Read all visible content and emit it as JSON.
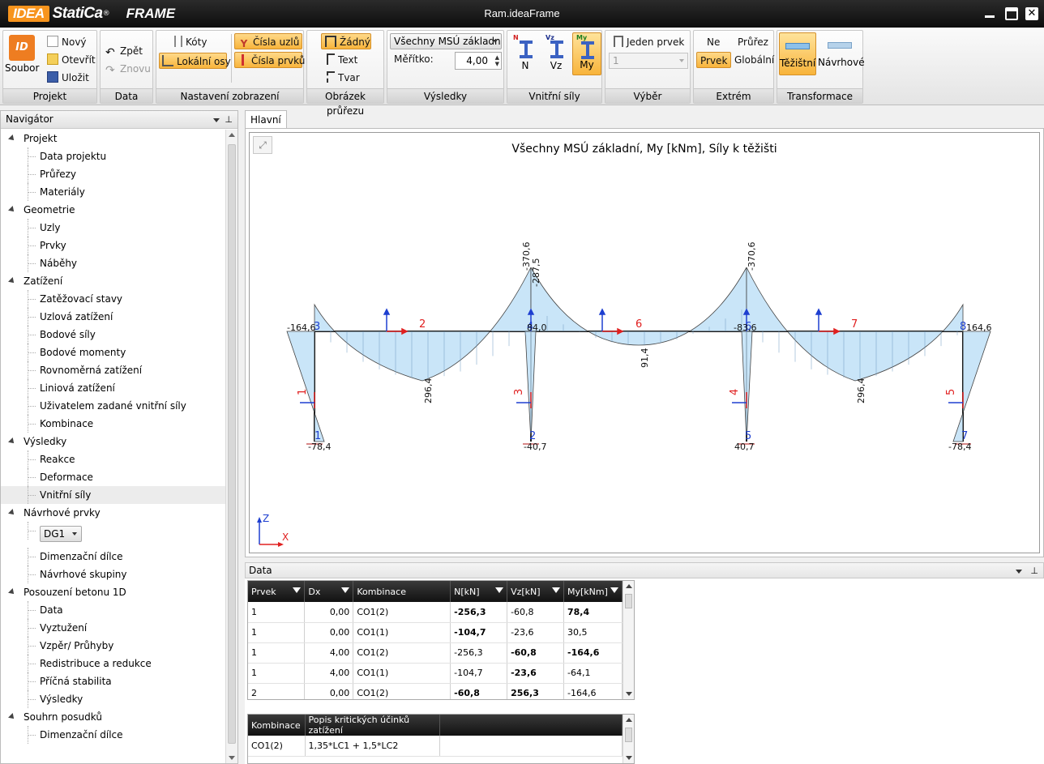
{
  "app": {
    "brand_idea": "IDEA",
    "brand_statica": "StatiCa",
    "brand_reg": "®",
    "product": "FRAME",
    "window_title": "Ram.ideaFrame"
  },
  "ribbon": {
    "projekt": {
      "label": "Projekt",
      "soubor": "Soubor",
      "novy": "Nový",
      "otevrit": "Otevřít",
      "ulozit": "Uložit"
    },
    "data": {
      "label": "Data",
      "zpet": "Zpět",
      "znovu": "Znovu"
    },
    "nastaveni": {
      "label": "Nastavení zobrazení",
      "koty": "Kóty",
      "lokalni_osy": "Lokální osy",
      "cisla_uzlu": "Čísla uzlů",
      "cisla_prvku": "Čísla prvků"
    },
    "obrazek": {
      "label": "Obrázek průřezu",
      "zadny": "Žádný",
      "text": "Text",
      "tvar": "Tvar"
    },
    "vysledky": {
      "label": "Výsledky",
      "combo": "Všechny MSÚ základní",
      "meritko_label": "Měřítko:",
      "meritko_value": "4,00"
    },
    "vnitrni": {
      "label": "Vnitřní síly",
      "n": "N",
      "vz": "Vz",
      "my": "My",
      "n_tag": "N",
      "vz_tag": "Vz",
      "my_tag": "My"
    },
    "vyber": {
      "label": "Výběr",
      "jeden_prvek": "Jeden prvek",
      "value": "1"
    },
    "extrem": {
      "label": "Extrém",
      "ne": "Ne",
      "prvek": "Prvek",
      "prurez": "Průřez",
      "globalni": "Globální"
    },
    "transformace": {
      "label": "Transformace",
      "tezistni": "Těžištní",
      "navrhove": "Návrhové"
    }
  },
  "navigator": {
    "title": "Navigátor",
    "items": [
      {
        "t": "sec",
        "label": "Projekt"
      },
      {
        "t": "sub",
        "label": "Data projektu"
      },
      {
        "t": "sub",
        "label": "Průřezy"
      },
      {
        "t": "sub",
        "label": "Materiály"
      },
      {
        "t": "sec",
        "label": "Geometrie"
      },
      {
        "t": "sub",
        "label": "Uzly"
      },
      {
        "t": "sub",
        "label": "Prvky"
      },
      {
        "t": "sub",
        "label": "Náběhy"
      },
      {
        "t": "sec",
        "label": "Zatížení"
      },
      {
        "t": "sub",
        "label": "Zatěžovací stavy"
      },
      {
        "t": "sub",
        "label": "Uzlová zatížení"
      },
      {
        "t": "sub",
        "label": "Bodové síly"
      },
      {
        "t": "sub",
        "label": "Bodové momenty"
      },
      {
        "t": "sub",
        "label": "Rovnoměrná zatížení"
      },
      {
        "t": "sub",
        "label": "Liniová zatížení"
      },
      {
        "t": "sub",
        "label": "Uživatelem zadané vnitřní síly"
      },
      {
        "t": "sub",
        "label": "Kombinace"
      },
      {
        "t": "sec",
        "label": "Výsledky"
      },
      {
        "t": "sub",
        "label": "Reakce"
      },
      {
        "t": "sub",
        "label": "Deformace"
      },
      {
        "t": "sub",
        "label": "Vnitřní síly",
        "sel": true
      },
      {
        "t": "sec",
        "label": "Návrhové prvky"
      },
      {
        "t": "combo",
        "label": "DG1"
      },
      {
        "t": "sub",
        "label": "Dimenzační dílce"
      },
      {
        "t": "sub",
        "label": "Návrhové skupiny"
      },
      {
        "t": "sec",
        "label": "Posouzení betonu 1D"
      },
      {
        "t": "sub",
        "label": "Data"
      },
      {
        "t": "sub",
        "label": "Vyztužení"
      },
      {
        "t": "sub",
        "label": "Vzpěr/ Průhyby"
      },
      {
        "t": "sub",
        "label": "Redistribuce a redukce"
      },
      {
        "t": "sub",
        "label": "Příčná stabilita"
      },
      {
        "t": "sub",
        "label": "Výsledky"
      },
      {
        "t": "sec",
        "label": "Souhrn posudků"
      },
      {
        "t": "sub",
        "label": "Dimenzační dílce"
      }
    ]
  },
  "main": {
    "tab": "Hlavní",
    "title": "Všechny MSÚ základní, My [kNm], Síly k těžišti",
    "axis_z": "Z",
    "axis_x": "X"
  },
  "diagram": {
    "member_labels": [
      "1",
      "2",
      "3",
      "4",
      "5",
      "6",
      "7"
    ],
    "node_labels": [
      "1",
      "2",
      "3",
      "4",
      "5",
      "6",
      "7",
      "8"
    ],
    "values": [
      "-164,6",
      "-370,6",
      "-287,5",
      "-370,6",
      "84,0",
      "-83,6",
      "164,6",
      "296,4",
      "91,4",
      "296,4",
      "-78,4",
      "-40,7",
      "40,7",
      "-78,4"
    ]
  },
  "data_panel": {
    "title": "Data",
    "columns": [
      "Prvek",
      "Dx",
      "Kombinace",
      "N[kN]",
      "Vz[kN]",
      "My[kNm]"
    ],
    "rows": [
      [
        "1",
        "0,00",
        "CO1(2)",
        "-256,3",
        "-60,8",
        "78,4"
      ],
      [
        "1",
        "0,00",
        "CO1(1)",
        "-104,7",
        "-23,6",
        "30,5"
      ],
      [
        "1",
        "4,00",
        "CO1(2)",
        "-256,3",
        "-60,8",
        "-164,6"
      ],
      [
        "1",
        "4,00",
        "CO1(1)",
        "-104,7",
        "-23,6",
        "-64,1"
      ],
      [
        "2",
        "0,00",
        "CO1(2)",
        "-60,8",
        "256,3",
        "-164,6"
      ]
    ],
    "bold": [
      [
        0,
        3
      ],
      [
        0,
        5
      ],
      [
        1,
        3
      ],
      [
        2,
        4
      ],
      [
        2,
        5
      ],
      [
        3,
        4
      ],
      [
        4,
        3
      ],
      [
        4,
        4
      ]
    ],
    "comb_columns": [
      "Kombinace",
      "Popis kritických účinků zatížení"
    ],
    "comb_rows": [
      [
        "CO1(2)",
        "1,35*LC1 + 1,5*LC2"
      ]
    ]
  }
}
